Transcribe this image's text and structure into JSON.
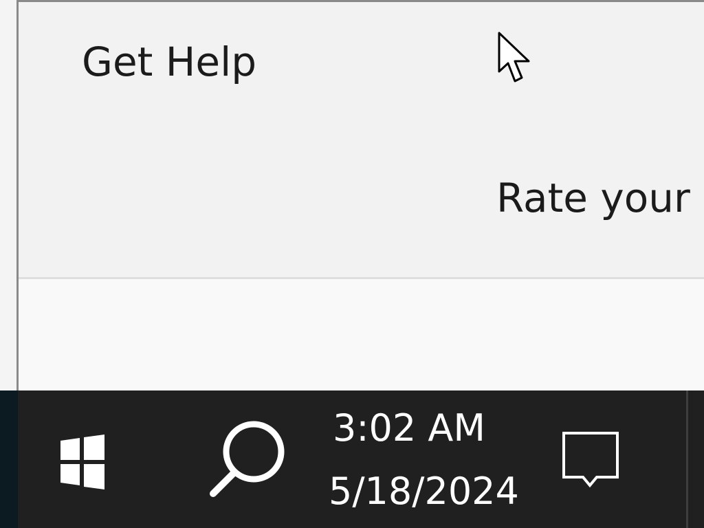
{
  "window": {
    "menu_items": [
      {
        "label": "Get Help"
      },
      {
        "label": "Rate your"
      }
    ]
  },
  "taskbar": {
    "start_icon": "windows-logo-icon",
    "search_icon": "search-icon",
    "clock": {
      "time": "3:02 AM",
      "date": "5/18/2024"
    },
    "notification_icon": "action-center-icon"
  },
  "colors": {
    "taskbar": "#202020",
    "menu_panel": "#f2f2f2",
    "text": "#1b1b1b",
    "taskbar_text": "#ffffff"
  }
}
